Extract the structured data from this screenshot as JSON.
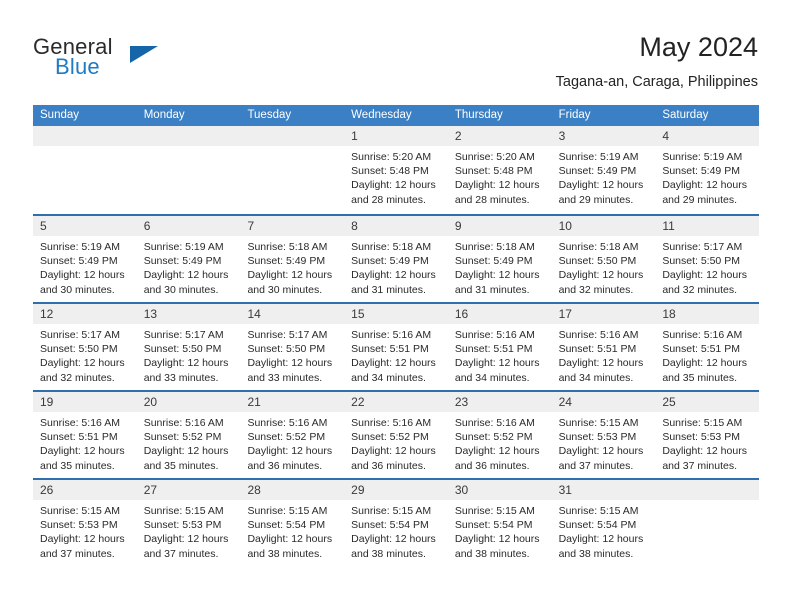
{
  "brand": {
    "word1": "General",
    "word2": "Blue",
    "logo_icon": "triangle-logo-icon",
    "accent_color": "#1e7bc4"
  },
  "header": {
    "title": "May 2024",
    "subtitle": "Tagana-an, Caraga, Philippines"
  },
  "theme": {
    "header_blue": "#3b7fc4",
    "separator_blue": "#2e6fb0",
    "day_band_gray": "#efefef"
  },
  "calendar": {
    "weekday_headers": [
      "Sunday",
      "Monday",
      "Tuesday",
      "Wednesday",
      "Thursday",
      "Friday",
      "Saturday"
    ],
    "weeks": [
      [
        {
          "day": "",
          "lines": []
        },
        {
          "day": "",
          "lines": []
        },
        {
          "day": "",
          "lines": []
        },
        {
          "day": "1",
          "lines": [
            "Sunrise: 5:20 AM",
            "Sunset: 5:48 PM",
            "Daylight: 12 hours",
            "and 28 minutes."
          ]
        },
        {
          "day": "2",
          "lines": [
            "Sunrise: 5:20 AM",
            "Sunset: 5:48 PM",
            "Daylight: 12 hours",
            "and 28 minutes."
          ]
        },
        {
          "day": "3",
          "lines": [
            "Sunrise: 5:19 AM",
            "Sunset: 5:49 PM",
            "Daylight: 12 hours",
            "and 29 minutes."
          ]
        },
        {
          "day": "4",
          "lines": [
            "Sunrise: 5:19 AM",
            "Sunset: 5:49 PM",
            "Daylight: 12 hours",
            "and 29 minutes."
          ]
        }
      ],
      [
        {
          "day": "5",
          "lines": [
            "Sunrise: 5:19 AM",
            "Sunset: 5:49 PM",
            "Daylight: 12 hours",
            "and 30 minutes."
          ]
        },
        {
          "day": "6",
          "lines": [
            "Sunrise: 5:19 AM",
            "Sunset: 5:49 PM",
            "Daylight: 12 hours",
            "and 30 minutes."
          ]
        },
        {
          "day": "7",
          "lines": [
            "Sunrise: 5:18 AM",
            "Sunset: 5:49 PM",
            "Daylight: 12 hours",
            "and 30 minutes."
          ]
        },
        {
          "day": "8",
          "lines": [
            "Sunrise: 5:18 AM",
            "Sunset: 5:49 PM",
            "Daylight: 12 hours",
            "and 31 minutes."
          ]
        },
        {
          "day": "9",
          "lines": [
            "Sunrise: 5:18 AM",
            "Sunset: 5:49 PM",
            "Daylight: 12 hours",
            "and 31 minutes."
          ]
        },
        {
          "day": "10",
          "lines": [
            "Sunrise: 5:18 AM",
            "Sunset: 5:50 PM",
            "Daylight: 12 hours",
            "and 32 minutes."
          ]
        },
        {
          "day": "11",
          "lines": [
            "Sunrise: 5:17 AM",
            "Sunset: 5:50 PM",
            "Daylight: 12 hours",
            "and 32 minutes."
          ]
        }
      ],
      [
        {
          "day": "12",
          "lines": [
            "Sunrise: 5:17 AM",
            "Sunset: 5:50 PM",
            "Daylight: 12 hours",
            "and 32 minutes."
          ]
        },
        {
          "day": "13",
          "lines": [
            "Sunrise: 5:17 AM",
            "Sunset: 5:50 PM",
            "Daylight: 12 hours",
            "and 33 minutes."
          ]
        },
        {
          "day": "14",
          "lines": [
            "Sunrise: 5:17 AM",
            "Sunset: 5:50 PM",
            "Daylight: 12 hours",
            "and 33 minutes."
          ]
        },
        {
          "day": "15",
          "lines": [
            "Sunrise: 5:16 AM",
            "Sunset: 5:51 PM",
            "Daylight: 12 hours",
            "and 34 minutes."
          ]
        },
        {
          "day": "16",
          "lines": [
            "Sunrise: 5:16 AM",
            "Sunset: 5:51 PM",
            "Daylight: 12 hours",
            "and 34 minutes."
          ]
        },
        {
          "day": "17",
          "lines": [
            "Sunrise: 5:16 AM",
            "Sunset: 5:51 PM",
            "Daylight: 12 hours",
            "and 34 minutes."
          ]
        },
        {
          "day": "18",
          "lines": [
            "Sunrise: 5:16 AM",
            "Sunset: 5:51 PM",
            "Daylight: 12 hours",
            "and 35 minutes."
          ]
        }
      ],
      [
        {
          "day": "19",
          "lines": [
            "Sunrise: 5:16 AM",
            "Sunset: 5:51 PM",
            "Daylight: 12 hours",
            "and 35 minutes."
          ]
        },
        {
          "day": "20",
          "lines": [
            "Sunrise: 5:16 AM",
            "Sunset: 5:52 PM",
            "Daylight: 12 hours",
            "and 35 minutes."
          ]
        },
        {
          "day": "21",
          "lines": [
            "Sunrise: 5:16 AM",
            "Sunset: 5:52 PM",
            "Daylight: 12 hours",
            "and 36 minutes."
          ]
        },
        {
          "day": "22",
          "lines": [
            "Sunrise: 5:16 AM",
            "Sunset: 5:52 PM",
            "Daylight: 12 hours",
            "and 36 minutes."
          ]
        },
        {
          "day": "23",
          "lines": [
            "Sunrise: 5:16 AM",
            "Sunset: 5:52 PM",
            "Daylight: 12 hours",
            "and 36 minutes."
          ]
        },
        {
          "day": "24",
          "lines": [
            "Sunrise: 5:15 AM",
            "Sunset: 5:53 PM",
            "Daylight: 12 hours",
            "and 37 minutes."
          ]
        },
        {
          "day": "25",
          "lines": [
            "Sunrise: 5:15 AM",
            "Sunset: 5:53 PM",
            "Daylight: 12 hours",
            "and 37 minutes."
          ]
        }
      ],
      [
        {
          "day": "26",
          "lines": [
            "Sunrise: 5:15 AM",
            "Sunset: 5:53 PM",
            "Daylight: 12 hours",
            "and 37 minutes."
          ]
        },
        {
          "day": "27",
          "lines": [
            "Sunrise: 5:15 AM",
            "Sunset: 5:53 PM",
            "Daylight: 12 hours",
            "and 37 minutes."
          ]
        },
        {
          "day": "28",
          "lines": [
            "Sunrise: 5:15 AM",
            "Sunset: 5:54 PM",
            "Daylight: 12 hours",
            "and 38 minutes."
          ]
        },
        {
          "day": "29",
          "lines": [
            "Sunrise: 5:15 AM",
            "Sunset: 5:54 PM",
            "Daylight: 12 hours",
            "and 38 minutes."
          ]
        },
        {
          "day": "30",
          "lines": [
            "Sunrise: 5:15 AM",
            "Sunset: 5:54 PM",
            "Daylight: 12 hours",
            "and 38 minutes."
          ]
        },
        {
          "day": "31",
          "lines": [
            "Sunrise: 5:15 AM",
            "Sunset: 5:54 PM",
            "Daylight: 12 hours",
            "and 38 minutes."
          ]
        },
        {
          "day": "",
          "lines": []
        }
      ]
    ]
  }
}
